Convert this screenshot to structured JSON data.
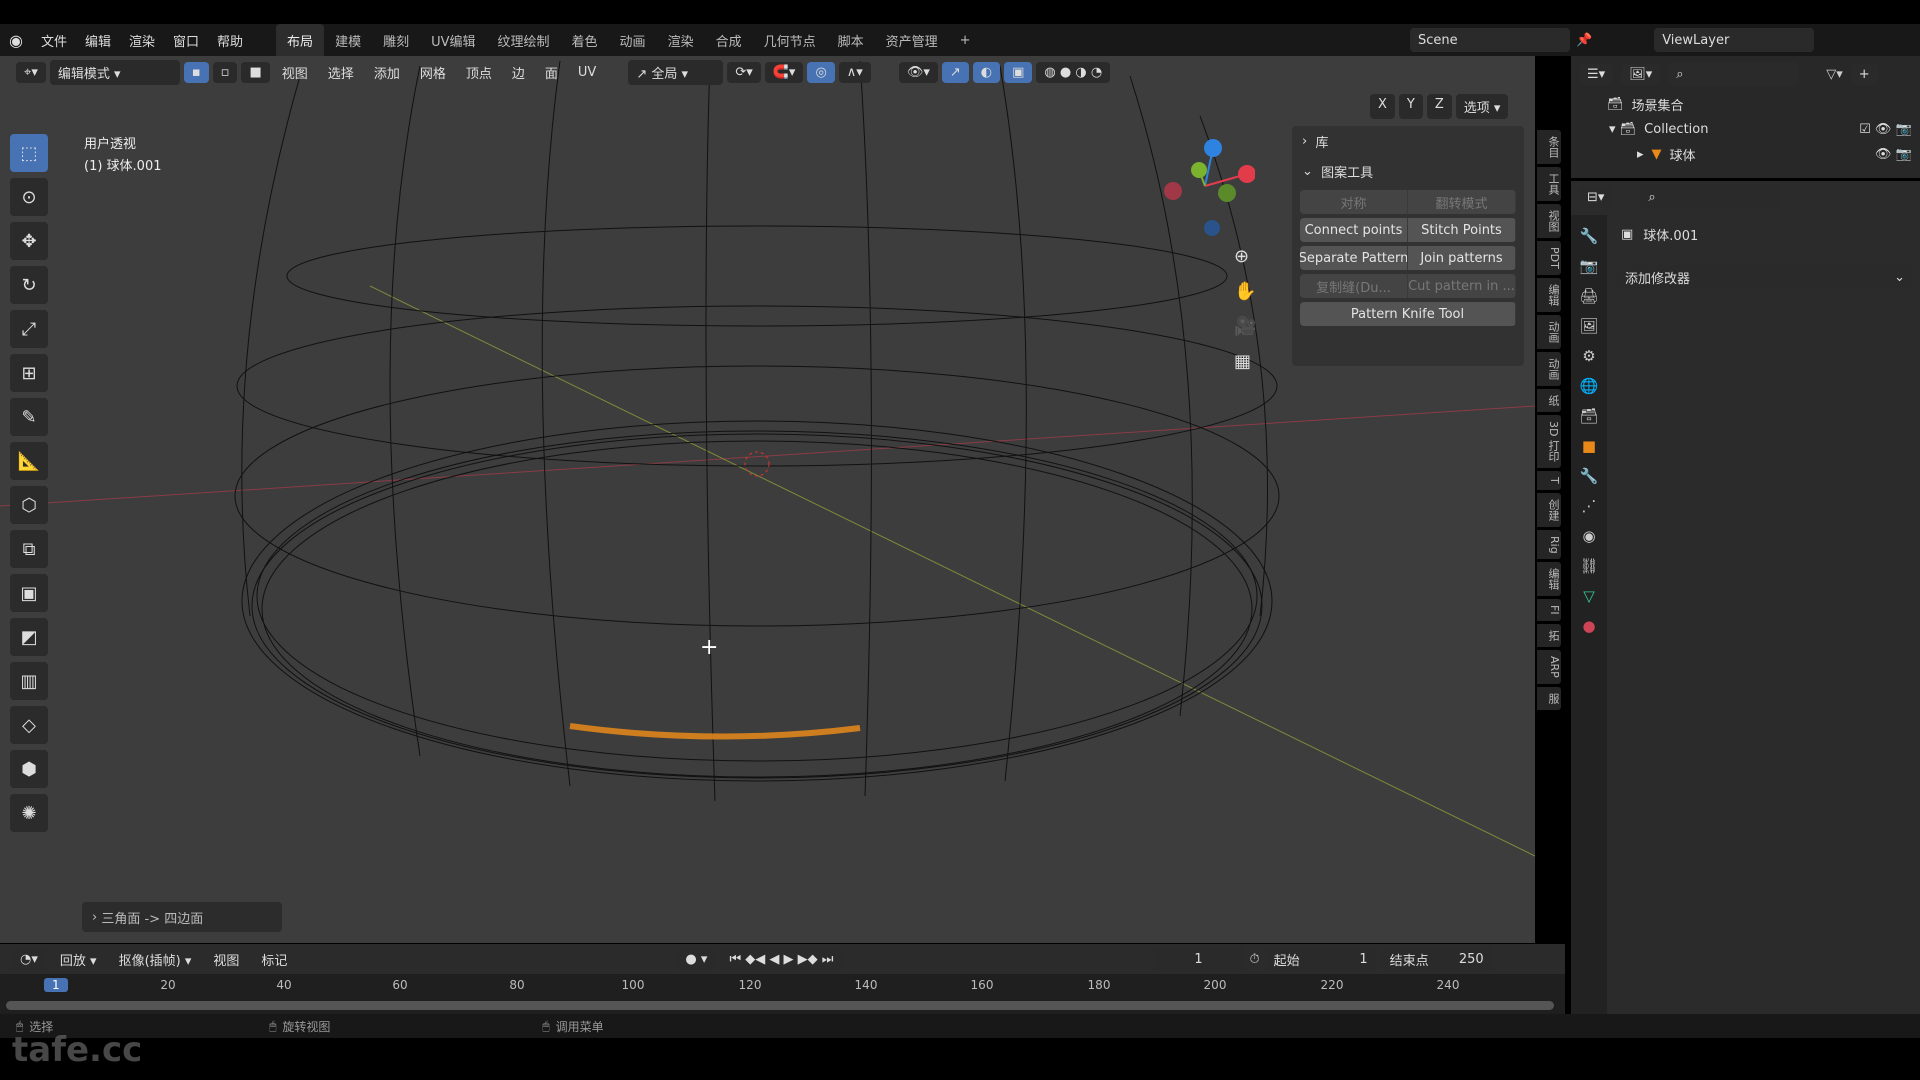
{
  "menu": {
    "items": [
      "文件",
      "编辑",
      "渲染",
      "窗口",
      "帮助"
    ],
    "workspaces": [
      "布局",
      "建模",
      "雕刻",
      "UV编辑",
      "纹理绘制",
      "着色",
      "动画",
      "渲染",
      "合成",
      "几何节点",
      "脚本",
      "资产管理"
    ],
    "active_workspace": "布局",
    "add": "+"
  },
  "scene": {
    "name": "Scene",
    "view_layer": "ViewLayer"
  },
  "header": {
    "mode": "编辑模式",
    "menus": [
      "视图",
      "选择",
      "添加",
      "网格",
      "顶点",
      "边",
      "面",
      "UV"
    ],
    "orientation": "全局",
    "axes": [
      "X",
      "Y",
      "Z"
    ],
    "options": "选项"
  },
  "viewport": {
    "view_name": "用户透视",
    "object_label": "(1) 球体.001",
    "last_op": "三角面 -> 四边面",
    "gizmo_axes": [
      "X",
      "Y",
      "Z"
    ]
  },
  "npanel": {
    "library": "库",
    "section": "图案工具",
    "buttons": [
      [
        "对称",
        "翻转模式"
      ],
      [
        "Connect points",
        "Stitch Points"
      ],
      [
        "Separate Pattern",
        "Join patterns"
      ],
      [
        "复制缝(Du...",
        "Cut pattern in ..."
      ],
      [
        "Pattern Knife Tool"
      ]
    ],
    "tabs": [
      "条目",
      "工具",
      "视图",
      "PDT",
      "编辑",
      "动画",
      "动画",
      "纸",
      "3D 打印",
      "T",
      "创建",
      "Rig",
      "编辑",
      "FI",
      "拓",
      "ARP",
      "服"
    ]
  },
  "outliner": {
    "root": "场景集合",
    "collection": "Collection",
    "object": "球体"
  },
  "properties": {
    "object": "球体.001",
    "add_modifier": "添加修改器"
  },
  "timeline": {
    "playback": "回放",
    "keying": "抠像(插帧)",
    "view": "视图",
    "marker": "标记",
    "current_frame": "1",
    "start_label": "起始",
    "start": "1",
    "end_label": "结束点",
    "end": "250",
    "ticks": [
      "20",
      "40",
      "60",
      "80",
      "100",
      "120",
      "140",
      "160",
      "180",
      "200",
      "220",
      "240"
    ]
  },
  "status": {
    "select": "选择",
    "rotate": "旋转视图",
    "menu": "调用菜单"
  },
  "watermark": "tafe.cc",
  "colors": {
    "accent": "#4772b3",
    "selected_edge": "#e8891a",
    "x_axis": "#e23c4b",
    "y_axis": "#7bb32e",
    "z_axis": "#2f83e0"
  }
}
